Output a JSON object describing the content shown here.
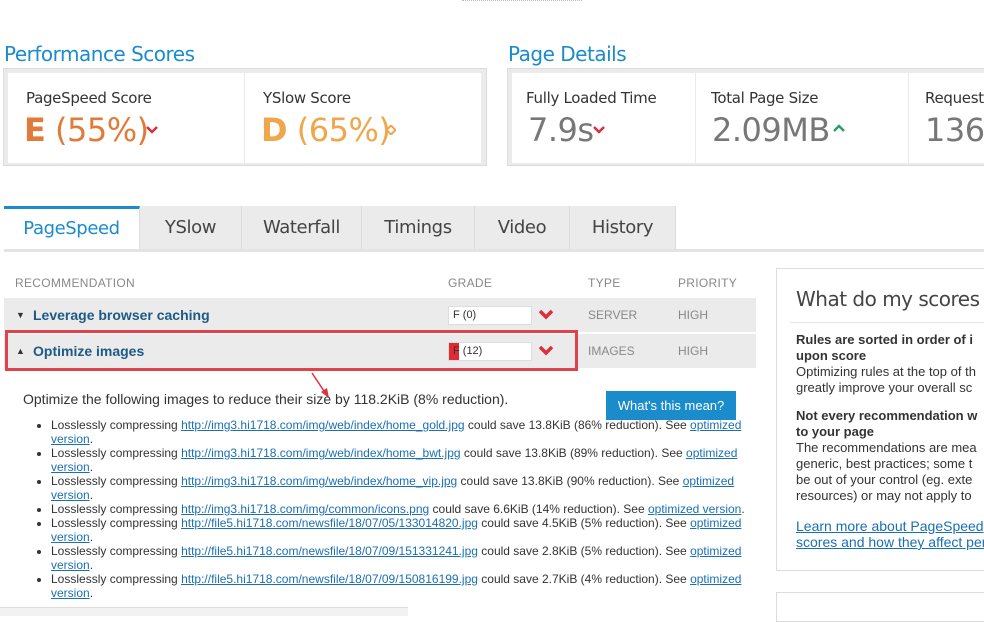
{
  "performance": {
    "title": "Performance Scores",
    "pagespeed": {
      "label": "PageSpeed Score",
      "grade": "E",
      "percent": "(55%)",
      "trend_icon": "chevron-down-icon"
    },
    "yslow": {
      "label": "YSlow Score",
      "grade": "D",
      "percent": "(65%)",
      "trend_icon": "diamond-icon"
    }
  },
  "details": {
    "title": "Page Details",
    "loaded": {
      "label": "Fully Loaded Time",
      "value": "7.9s",
      "trend_icon": "chevron-down-icon"
    },
    "size": {
      "label": "Total Page Size",
      "value": "2.09MB",
      "trend_icon": "chevron-up-icon"
    },
    "requests": {
      "label": "Requests",
      "value": "136"
    }
  },
  "tabs": [
    "PageSpeed",
    "YSlow",
    "Waterfall",
    "Timings",
    "Video",
    "History"
  ],
  "table": {
    "headers": {
      "recommendation": "RECOMMENDATION",
      "grade": "GRADE",
      "type": "TYPE",
      "priority": "PRIORITY"
    },
    "rows": [
      {
        "name": "Leverage browser caching",
        "grade": "F (0)",
        "type": "SERVER",
        "priority": "HIGH",
        "expanded": false
      },
      {
        "name": "Optimize images",
        "grade": "F (12)",
        "grade_fill_fraction": 0.12,
        "type": "IMAGES",
        "priority": "HIGH",
        "expanded": true
      }
    ]
  },
  "detail_panel": {
    "intro": "Optimize the following images to reduce their size by 118.2KiB (8% reduction).",
    "button": "What's this mean?",
    "items": [
      {
        "prefix": "Losslessly compressing ",
        "link": "http://img3.hi1718.com/img/web/index/home_gold.jpg",
        "middle": " could save 13.8KiB (86% reduction). See ",
        "link2": "optimized version",
        "suffix": "."
      },
      {
        "prefix": "Losslessly compressing ",
        "link": "http://img3.hi1718.com/img/web/index/home_bwt.jpg",
        "middle": " could save 13.8KiB (89% reduction). See ",
        "link2": "optimized version",
        "suffix": "."
      },
      {
        "prefix": "Losslessly compressing ",
        "link": "http://img3.hi1718.com/img/web/index/home_vip.jpg",
        "middle": " could save 13.8KiB (90% reduction). See ",
        "link2": "optimized version",
        "suffix": "."
      },
      {
        "prefix": "Losslessly compressing ",
        "link": "http://img3.hi1718.com/img/common/icons.png",
        "middle": " could save 6.6KiB (14% reduction). See ",
        "link2": "optimized version",
        "suffix": "."
      },
      {
        "prefix": "Losslessly compressing ",
        "link": "http://file5.hi1718.com/newsfile/18/07/05/133014820.jpg",
        "middle": " could save 4.5KiB (5% reduction). See ",
        "link2": "optimized version",
        "suffix": "."
      },
      {
        "prefix": "Losslessly compressing ",
        "link": "http://file5.hi1718.com/newsfile/18/07/09/151331241.jpg",
        "middle": " could save 2.8KiB (5% reduction). See ",
        "link2": "optimized version",
        "suffix": "."
      },
      {
        "prefix": "Losslessly compressing ",
        "link": "http://file5.hi1718.com/newsfile/18/07/09/150816199.jpg",
        "middle": " could save 2.7KiB (4% reduction). See ",
        "link2": "optimized version",
        "suffix": "."
      }
    ]
  },
  "sidebar": {
    "title": "What do my scores",
    "b1": "Rules are sorted in order of i",
    "b1b": "upon score",
    "t1": "Optimizing rules at the top of th",
    "t1b": "greatly improve your overall sc",
    "b2": "Not every recommendation w",
    "b2b": "to your page",
    "t2a": "The recommendations are mea",
    "t2b": "generic, best practices; some t",
    "t2c": "be out of your control (eg. exte",
    "t2d": "resources) or may not apply to",
    "link1": "Learn more about PageSpeed",
    "link2": "scores and how they affect per"
  },
  "colors": {
    "accent": "#1a8ccc",
    "grade_e": "#e07b39",
    "grade_d": "#f0a64a",
    "bad": "#d9303a",
    "good": "#2aa06b"
  }
}
